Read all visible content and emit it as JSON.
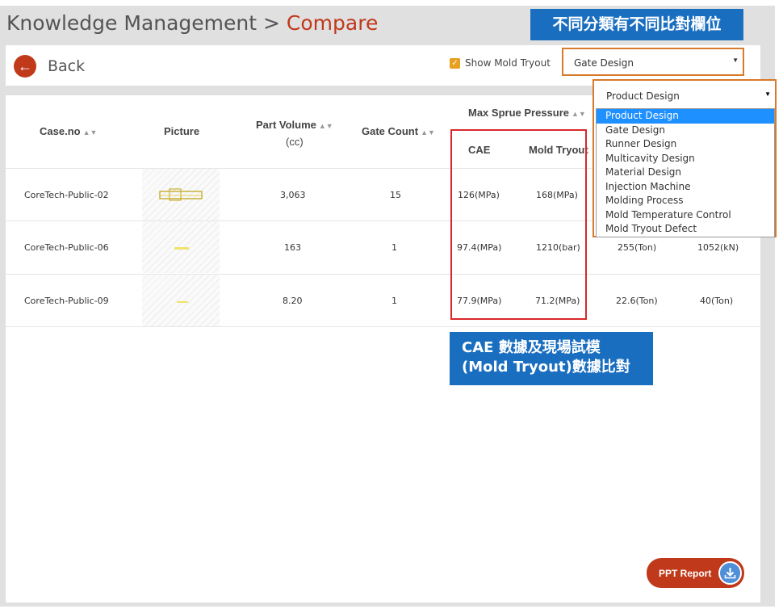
{
  "breadcrumb": {
    "parent": "Knowledge Management",
    "separator": ">",
    "current": "Compare"
  },
  "annotations": {
    "top_banner": "不同分類有不同比對欄位",
    "mid_banner_line1": "CAE 數據及現場試模",
    "mid_banner_line2": "(Mold Tryout)數據比對"
  },
  "toolbar": {
    "back_label": "Back",
    "show_tryout_label": "Show Mold Tryout",
    "show_tryout_checked": true,
    "category_selected": "Gate Design"
  },
  "dropdown": {
    "selected": "Product Design",
    "options": [
      "Product Design",
      "Gate Design",
      "Runner Design",
      "Multicavity Design",
      "Material Design",
      "Injection Machine",
      "Molding Process",
      "Mold Temperature Control",
      "Mold Tryout Defect"
    ],
    "highlighted": "Product Design"
  },
  "table": {
    "headers": {
      "case_no": "Case.no",
      "picture": "Picture",
      "part_volume_line1": "Part Volume",
      "part_volume_line2": "(cc)",
      "gate_count": "Gate Count",
      "max_sprue_pressure": "Max Sprue Pressure",
      "cae": "CAE",
      "mold_tryout": "Mold Tryout"
    },
    "rows": [
      {
        "case_no": "CoreTech-Public-02",
        "part_volume": "3,063",
        "gate_count": "15",
        "cae": "126(MPa)",
        "mold_tryout": "168(MPa)",
        "col7": "",
        "col8": ""
      },
      {
        "case_no": "CoreTech-Public-06",
        "part_volume": "163",
        "gate_count": "1",
        "cae": "97.4(MPa)",
        "mold_tryout": "1210(bar)",
        "col7": "255(Ton)",
        "col8": "1052(kN)"
      },
      {
        "case_no": "CoreTech-Public-09",
        "part_volume": "8.20",
        "gate_count": "1",
        "cae": "77.9(MPa)",
        "mold_tryout": "71.2(MPa)",
        "col7": "22.6(Ton)",
        "col8": "40(Ton)"
      }
    ]
  },
  "ppt_button": {
    "label": "PPT Report",
    "icon": "download-icon"
  },
  "colors": {
    "brand_red": "#c0391b",
    "banner_blue": "#1a6ec0",
    "highlight_orange": "#d77a2a",
    "compare_red": "#d9282a",
    "option_active": "#1e90ff"
  }
}
